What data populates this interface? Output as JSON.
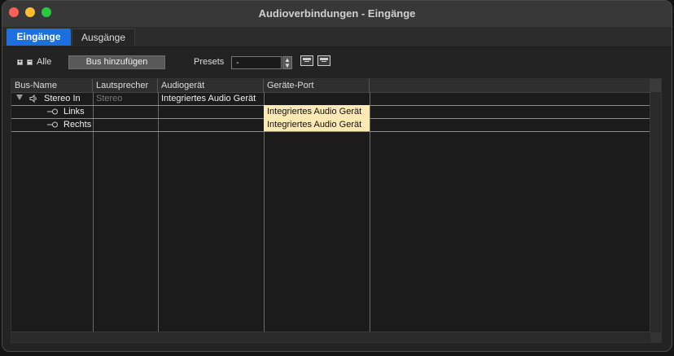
{
  "window": {
    "title": "Audioverbindungen - Eingänge"
  },
  "tabs": [
    {
      "label": "Eingänge",
      "active": true
    },
    {
      "label": "Ausgänge",
      "active": false
    }
  ],
  "toolbar": {
    "expand_icon": "plus-square-icon",
    "collapse_icon": "minus-square-icon",
    "all_label": "Alle",
    "add_bus_label": "Bus hinzufügen",
    "presets_label": "Presets",
    "presets_value": "-"
  },
  "table": {
    "columns": [
      "Bus-Name",
      "Lautsprecher",
      "Audiogerät",
      "Geräte-Port"
    ],
    "rows": [
      {
        "bus": "Stereo In",
        "speaker": "Stereo",
        "device": "Integriertes Audio Gerät",
        "port": "",
        "type": "bus"
      },
      {
        "bus": "Links",
        "speaker": "",
        "device": "",
        "port": "Integriertes Audio Gerät",
        "type": "channel"
      },
      {
        "bus": "Rechts",
        "speaker": "",
        "device": "",
        "port": "Integriertes Audio Gerät",
        "type": "channel"
      }
    ]
  },
  "colors": {
    "tab_active": "#1d6fe0",
    "port_highlight": "#fce9b3"
  }
}
